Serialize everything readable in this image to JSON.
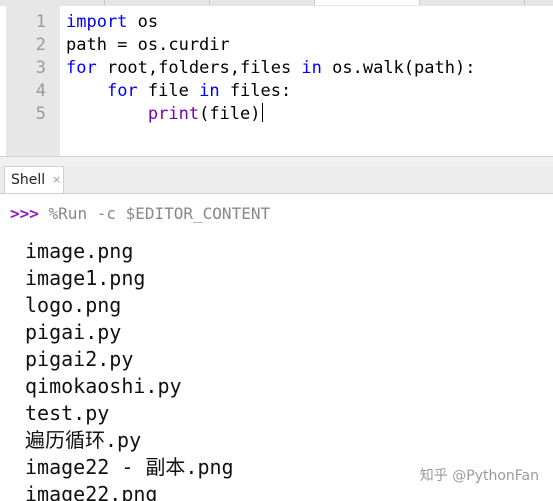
{
  "editor": {
    "tabs": [
      "",
      "",
      "",
      "",
      ""
    ],
    "line_numbers": [
      "1",
      "2",
      "3",
      "4",
      "5"
    ],
    "code": [
      [
        {
          "t": "import",
          "c": "kw"
        },
        {
          "t": " os",
          "c": ""
        }
      ],
      [
        {
          "t": "path = os.curdir",
          "c": ""
        }
      ],
      [
        {
          "t": "for",
          "c": "kw"
        },
        {
          "t": " root,folders,files ",
          "c": ""
        },
        {
          "t": "in",
          "c": "kw"
        },
        {
          "t": " os.walk(path):",
          "c": ""
        }
      ],
      [
        {
          "t": "    ",
          "c": ""
        },
        {
          "t": "for",
          "c": "kw"
        },
        {
          "t": " file ",
          "c": ""
        },
        {
          "t": "in",
          "c": "kw"
        },
        {
          "t": " files:",
          "c": ""
        }
      ],
      [
        {
          "t": "        ",
          "c": ""
        },
        {
          "t": "print",
          "c": "builtin"
        },
        {
          "t": "(file)",
          "c": ""
        }
      ]
    ]
  },
  "shell": {
    "tab_label": "Shell",
    "close_glyph": "×",
    "prompt_arrows": ">>>",
    "prompt_command": " %Run -c $EDITOR_CONTENT",
    "output_lines": [
      "image.png",
      "image1.png",
      "logo.png",
      "pigai.py",
      "pigai2.py",
      "qimokaoshi.py",
      "test.py",
      "遍历循环.py",
      "image22 - 副本.png",
      "image22.png"
    ]
  },
  "watermark": "知乎 @PythonFan",
  "colors": {
    "keyword": "#0000ff",
    "builtin": "#7a00b3",
    "prompt_arrows": "#8b23b5",
    "gutter_bg": "#e7e7e7"
  }
}
